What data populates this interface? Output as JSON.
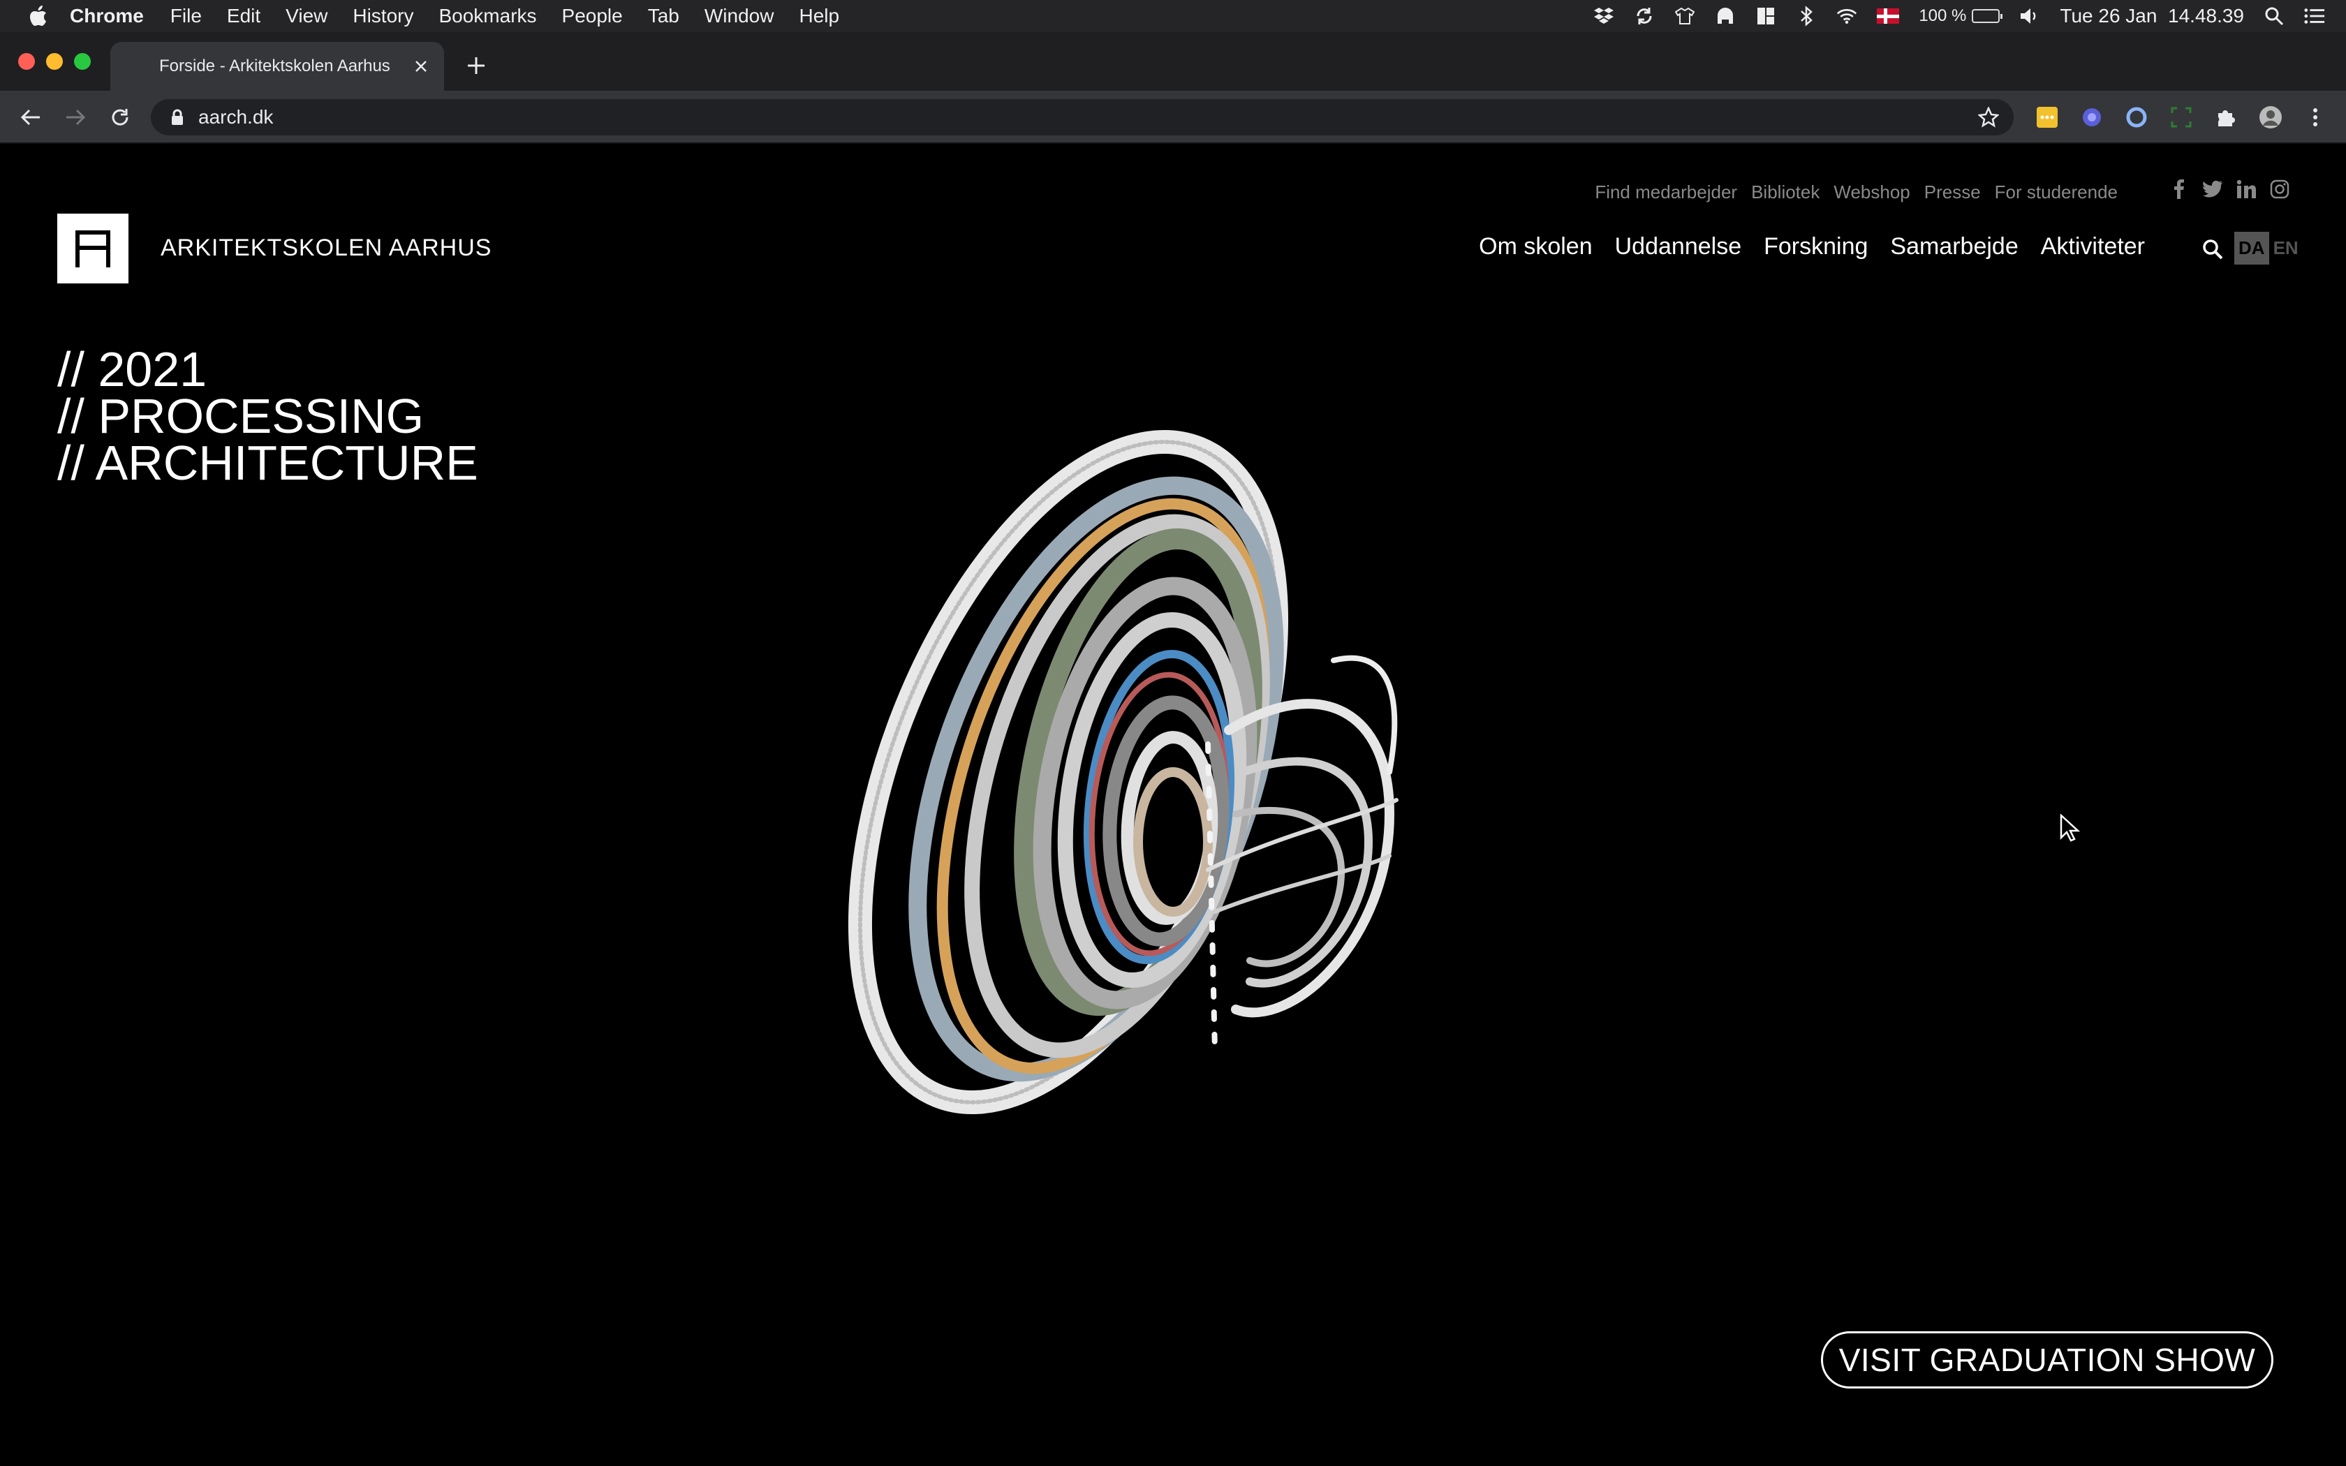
{
  "menubar": {
    "app_name": "Chrome",
    "items": [
      "File",
      "Edit",
      "View",
      "History",
      "Bookmarks",
      "People",
      "Tab",
      "Window",
      "Help"
    ],
    "battery": "100 %",
    "datetime": "Tue 26 Jan  14.48.39"
  },
  "browser": {
    "tab_title": "Forside - Arkitektskolen Aarhus",
    "url": "aarch.dk"
  },
  "site": {
    "logo_name": "ARKITEKTSKOLEN AARHUS",
    "utility_nav": [
      "Find medarbejder",
      "Bibliotek",
      "Webshop",
      "Presse",
      "For studerende"
    ],
    "social": [
      "facebook-icon",
      "twitter-icon",
      "linkedin-icon",
      "instagram-icon"
    ],
    "main_nav": [
      "Om skolen",
      "Uddannelse",
      "Forskning",
      "Samarbejde",
      "Aktiviteter"
    ],
    "lang": {
      "active": "DA",
      "inactive": "EN"
    },
    "headline": [
      "// 2021",
      "// PROCESSING",
      "// ARCHITECTURE"
    ],
    "cta_label": "VISIT GRADUATION SHOW"
  },
  "colors": {
    "page_background": "#000000",
    "menubar": "#252527",
    "toolbar": "#35363a",
    "omnibox": "#202124",
    "muted_text": "#8a8a8a"
  }
}
